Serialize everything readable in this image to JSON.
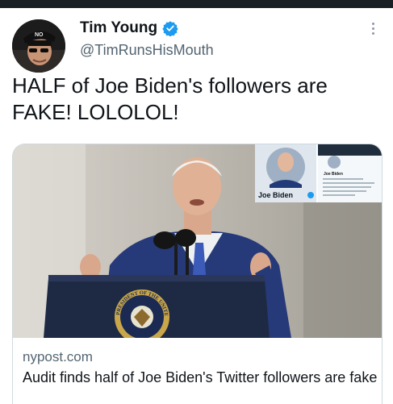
{
  "tweet": {
    "author": {
      "display_name": "Tim Young",
      "handle": "@TimRunsHisMouth",
      "verified": true,
      "avatar_hat_text": "NO"
    },
    "text": "HALF of Joe Biden's followers are FAKE!  LOLOLOL!",
    "card": {
      "domain": "nypost.com",
      "title": "Audit finds half of Joe Biden's Twitter followers are fake",
      "inset_profile_name": "Joe Biden",
      "inset_mini_name": "Joe Biden",
      "seal_text": "PRESIDENT OF THE UNITED"
    }
  },
  "colors": {
    "verified_blue": "#1d9bf0",
    "text_primary": "#0f1419",
    "text_secondary": "#536471",
    "border": "#cfd9de",
    "podium_navy": "#1e2a44",
    "seal_gold": "#c9a64a"
  }
}
